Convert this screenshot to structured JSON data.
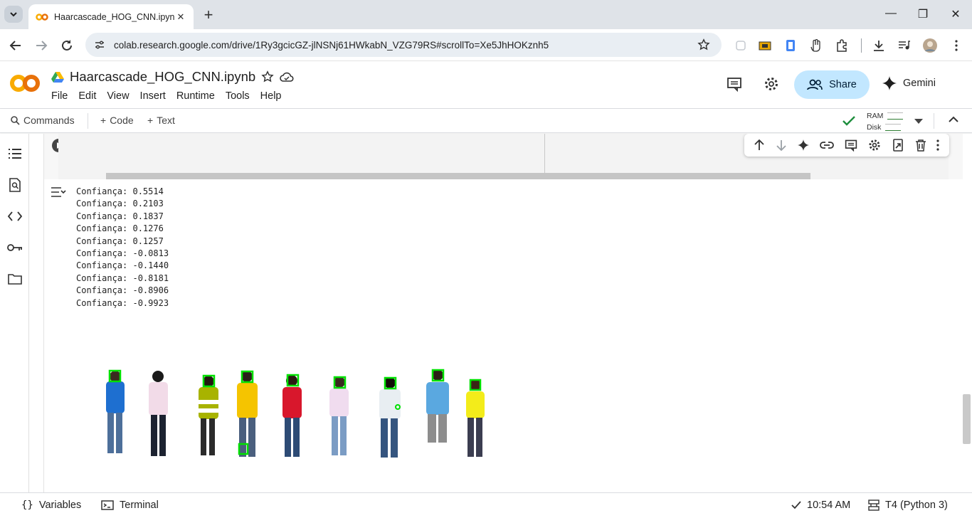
{
  "browser": {
    "tab_title": "Haarcascade_HOG_CNN.ipynb",
    "url": "colab.research.google.com/drive/1Ry3gcicGZ-jlNSNj61HWkabN_VZG79RS#scrollTo=Xe5JhHOKznh5"
  },
  "colab": {
    "notebook_name": "Haarcascade_HOG_CNN.ipynb",
    "menu": [
      "File",
      "Edit",
      "View",
      "Insert",
      "Runtime",
      "Tools",
      "Help"
    ],
    "share_label": "Share",
    "gemini_label": "Gemini"
  },
  "toolbar": {
    "commands_label": "Commands",
    "code_label": "Code",
    "text_label": "Text",
    "ram_label": "RAM",
    "disk_label": "Disk"
  },
  "output": {
    "lines": [
      "Confiança: 0.5514",
      "Confiança: 0.2103",
      "Confiança: 0.1837",
      "Confiança: 0.1276",
      "Confiança: 0.1257",
      "Confiança: -0.0813",
      "Confiança: -0.1440",
      "Confiança: -0.8181",
      "Confiança: -0.8906",
      "Confiança: -0.9923"
    ]
  },
  "status": {
    "variables_label": "Variables",
    "terminal_label": "Terminal",
    "time": "10:54 AM",
    "runtime": "T4 (Python 3)"
  },
  "colors": {
    "share_bg": "#c2e7ff",
    "detection_box": "#00e000",
    "colab_orange": "#f9ab00"
  },
  "icons": [
    "dropdown-icon",
    "colab-favicon",
    "close-icon",
    "plus-icon",
    "minimize-icon",
    "maximize-icon",
    "back-icon",
    "forward-icon",
    "reload-icon",
    "site-settings-icon",
    "bookmark-star-icon",
    "profile-avatar",
    "drive-icon",
    "star-icon",
    "cloud-icon",
    "comment-icon",
    "settings-gear-icon",
    "people-icon",
    "gemini-sparkle-icon",
    "search-icon",
    "check-icon",
    "chevron-up-icon",
    "toc-icon",
    "find-icon",
    "code-icon",
    "key-icon",
    "folder-icon",
    "play-icon",
    "arrow-up-icon",
    "arrow-down-icon",
    "link-icon",
    "trash-icon",
    "more-vert-icon",
    "output-toggle-icon",
    "terminal-icon"
  ]
}
